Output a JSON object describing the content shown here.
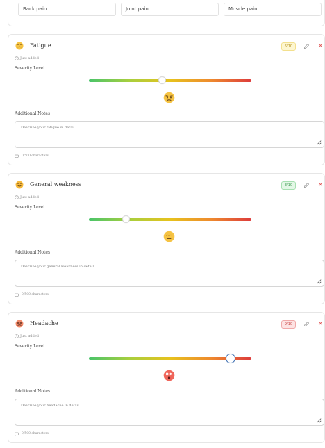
{
  "chips": [
    "Back pain",
    "Joint pain",
    "Muscle pain"
  ],
  "symptoms": [
    {
      "name": "Fatigue",
      "added": "Just added",
      "severity_label": "Severity Level",
      "severity": 5,
      "severity_badge": "5/10",
      "badge_bg": "#fdf6d0",
      "badge_border": "#f3e08e",
      "badge_color": "#b08a14",
      "slider_value": 0.45,
      "face": "worried-face",
      "notes_label": "Additional Notes",
      "notes_placeholder": "Describe your fatigue in detail...",
      "char_count": "0/500 characters"
    },
    {
      "name": "General weakness",
      "added": "Just added",
      "severity_label": "Severity Level",
      "severity": 3,
      "severity_badge": "3/10",
      "badge_bg": "#e3f7e6",
      "badge_border": "#a7e0b1",
      "badge_color": "#3f9b52",
      "slider_value": 0.23,
      "face": "neutral-face",
      "notes_label": "Additional Notes",
      "notes_placeholder": "Describe your general weakness in detail...",
      "char_count": "0/500 characters"
    },
    {
      "name": "Headache",
      "added": "Just added",
      "severity_label": "Severity Level",
      "severity": 9,
      "severity_badge": "9/10",
      "badge_bg": "#fde3e3",
      "badge_border": "#f0a9a9",
      "badge_color": "#c84a4a",
      "slider_value": 0.87,
      "face": "dizzy-face",
      "notes_label": "Additional Notes",
      "notes_placeholder": "Describe your headache in detail...",
      "char_count": "0/500 characters"
    }
  ]
}
